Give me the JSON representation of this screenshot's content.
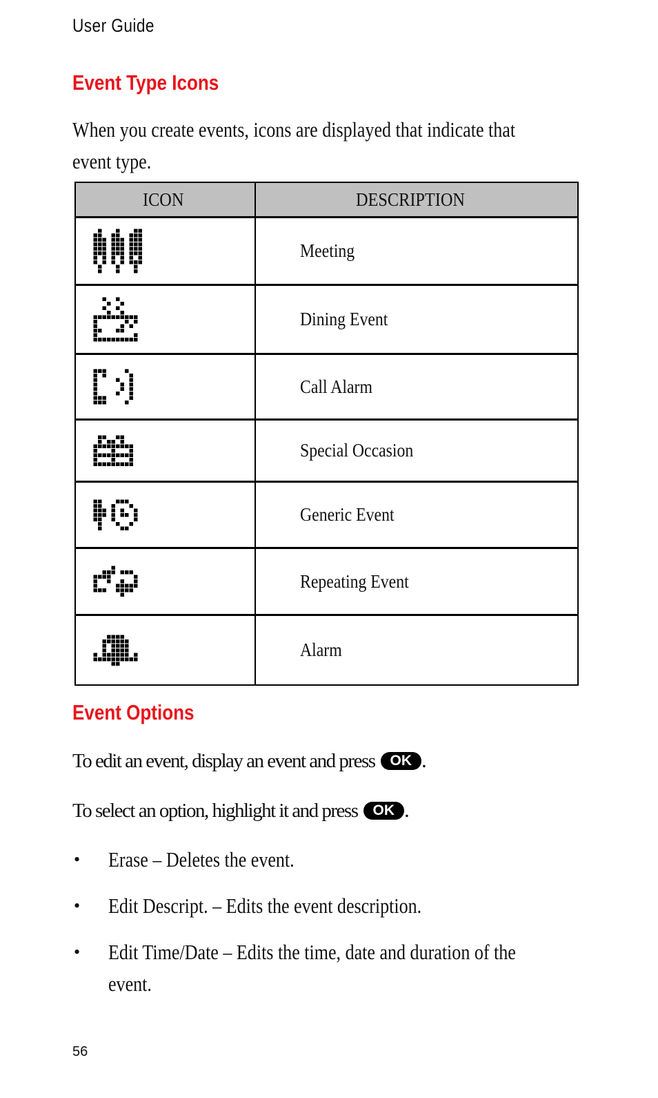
{
  "header": {
    "running_title": "User Guide"
  },
  "section1": {
    "title": "Event Type Icons",
    "intro_line1": "When you create events, icons are displayed that indicate that",
    "intro_line2": "event type."
  },
  "table": {
    "headers": [
      "ICON",
      "DESCRIPTION"
    ],
    "rows": [
      {
        "icon": "meeting-icon",
        "description": "Meeting"
      },
      {
        "icon": "dining-icon",
        "description": "Dining Event"
      },
      {
        "icon": "call-alarm-icon",
        "description": "Call Alarm"
      },
      {
        "icon": "gift-icon",
        "description": "Special Occasion"
      },
      {
        "icon": "generic-event-icon",
        "description": "Generic Event"
      },
      {
        "icon": "repeating-event-icon",
        "description": "Repeating Event"
      },
      {
        "icon": "alarm-bell-icon",
        "description": "Alarm"
      }
    ]
  },
  "section2": {
    "title": "Event Options",
    "para1": "To edit an event, display an event and press",
    "para2": "To select an option, highlight it and press",
    "ok_key": "OK",
    "period": ".",
    "bullets": [
      "Erase – Deletes the event.",
      "Edit Descript. – Edits the event description.",
      "Edit Time/Date – Edits the time, date and duration of the",
      "event."
    ],
    "bullet_char": "•"
  },
  "footer": {
    "page_number": "56"
  },
  "colors": {
    "heading": "#e8141c",
    "table_header_bg": "#c0c0c0"
  }
}
